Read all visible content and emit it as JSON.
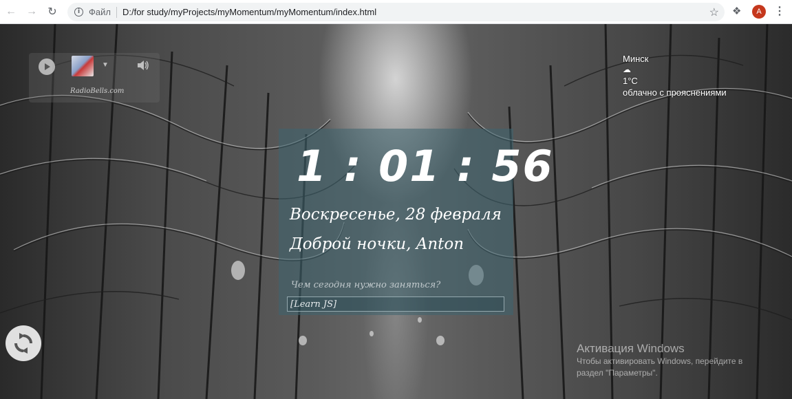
{
  "browser": {
    "scheme_label": "Файл",
    "url": "D:/for study/myProjects/myMomentum/myMomentum/index.html",
    "avatar_letter": "A",
    "icons": [
      "back-icon",
      "forward-icon",
      "reload-icon",
      "info-icon",
      "star-icon",
      "extensions-icon",
      "menu-icon"
    ]
  },
  "player": {
    "station_caption": "RadioBells.com",
    "icons": [
      "play-icon",
      "chevron-down-icon",
      "volume-icon"
    ]
  },
  "weather": {
    "city": "Минск",
    "icon": "cloud-icon",
    "temperature": "1°C",
    "description": "облачно с прояснениями"
  },
  "clock": {
    "time": "1 : 01 : 56",
    "date": "Воскресенье, 28 февраля",
    "greeting": "Доброй ночки, Anton"
  },
  "focus": {
    "label": "Чем сегодня нужно заняться?",
    "value": "[Learn JS]"
  },
  "refresh": {
    "icon": "refresh-icon"
  },
  "watermark": {
    "title": "Активация Windows",
    "line1": "Чтобы активировать Windows, перейдите в",
    "line2": "раздел \"Параметры\"."
  },
  "colors": {
    "panel": "#3e6470",
    "avatar": "#c5381d",
    "text": "#ffffff"
  }
}
